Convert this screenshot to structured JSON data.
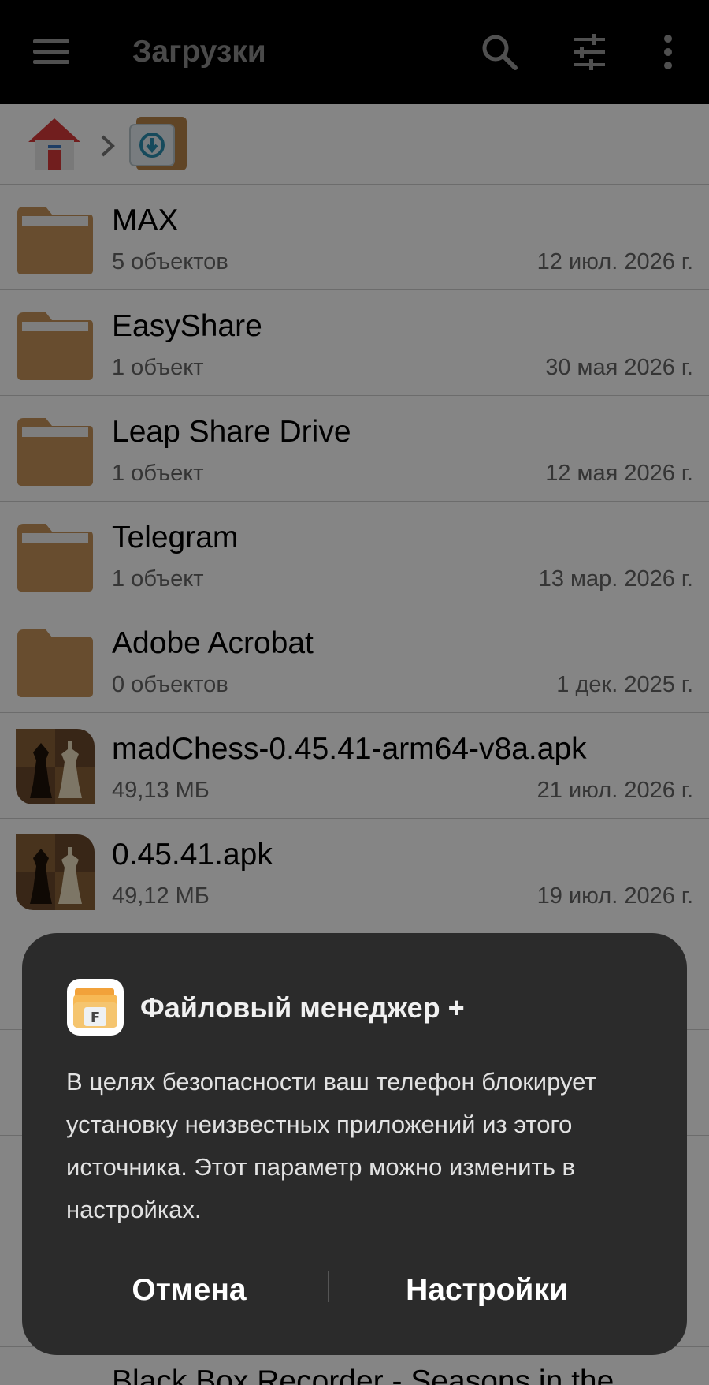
{
  "appbar": {
    "title": "Загрузки",
    "icons": [
      "menu-icon",
      "search-icon",
      "sliders-icon",
      "more-vertical-icon"
    ]
  },
  "breadcrumb": {
    "items": [
      "home-icon",
      "chevron-right-icon",
      "download-folder-icon"
    ]
  },
  "files": [
    {
      "name": "MAX",
      "meta": "5 объектов",
      "date": "12 июл. 2026 г.",
      "kind": "folder"
    },
    {
      "name": "EasyShare",
      "meta": "1 объект",
      "date": "30 мая 2026 г.",
      "kind": "folder"
    },
    {
      "name": "Leap Share Drive",
      "meta": "1 объект",
      "date": "12 мая 2026 г.",
      "kind": "folder"
    },
    {
      "name": "Telegram",
      "meta": "1 объект",
      "date": "13 мар. 2026 г.",
      "kind": "folder"
    },
    {
      "name": "Adobe Acrobat",
      "meta": "0 объектов",
      "date": "1 дек. 2025 г.",
      "kind": "folder"
    },
    {
      "name": "madChess-0.45.41-arm64-v8a.apk",
      "meta": "49,13 МБ",
      "date": "21 июл. 2026 г.",
      "kind": "apk"
    },
    {
      "name": "0.45.41.apk",
      "meta": "49,12 МБ",
      "date": "19 июл. 2026 г.",
      "kind": "apk"
    }
  ],
  "partial_row": {
    "name": "Black Box Recorder - Seasons in the"
  },
  "dialog": {
    "app_name": "Файловый менеджер +",
    "message": "В целях безопасности ваш телефон блокирует установку неизвестных приложений из этого источника. Этот параметр можно изменить в настройках.",
    "cancel_label": "Отмена",
    "settings_label": "Настройки"
  },
  "colors": {
    "appbar_bg": "#000000",
    "folder": "#c8955a",
    "dialog_bg": "#2b2b2b",
    "home_red": "#d93a3a"
  }
}
